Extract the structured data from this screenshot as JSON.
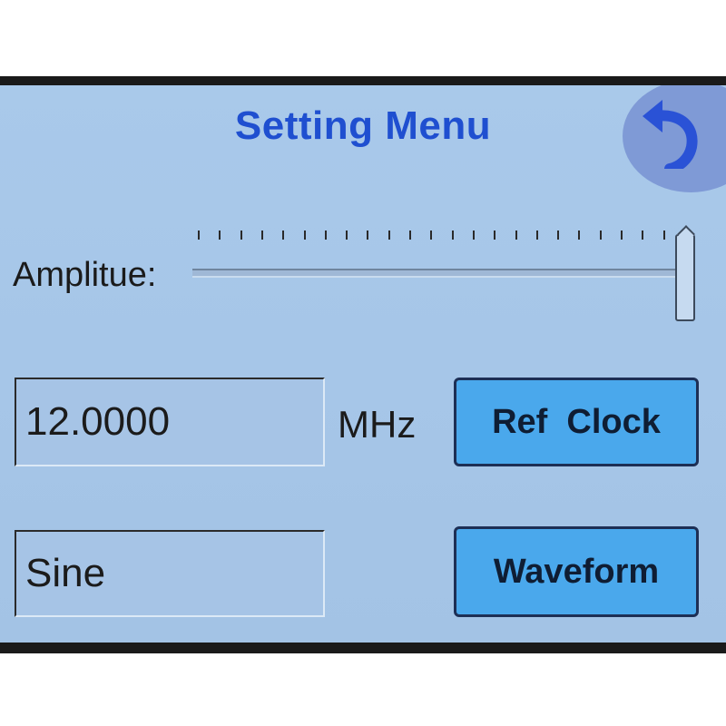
{
  "header": {
    "title": "Setting Menu"
  },
  "amplitude": {
    "label": "Amplitue:",
    "value_fraction": 1.0
  },
  "ref_clock": {
    "value": "12.0000",
    "unit": "MHz",
    "button_label": "Ref  Clock"
  },
  "waveform": {
    "value": "Sine",
    "button_label": "Waveform"
  },
  "colors": {
    "title": "#1f4fd0",
    "screen_bg": "#a6c6e8",
    "button_bg": "#4aa8ec",
    "back_button": "#7f9ad6"
  }
}
